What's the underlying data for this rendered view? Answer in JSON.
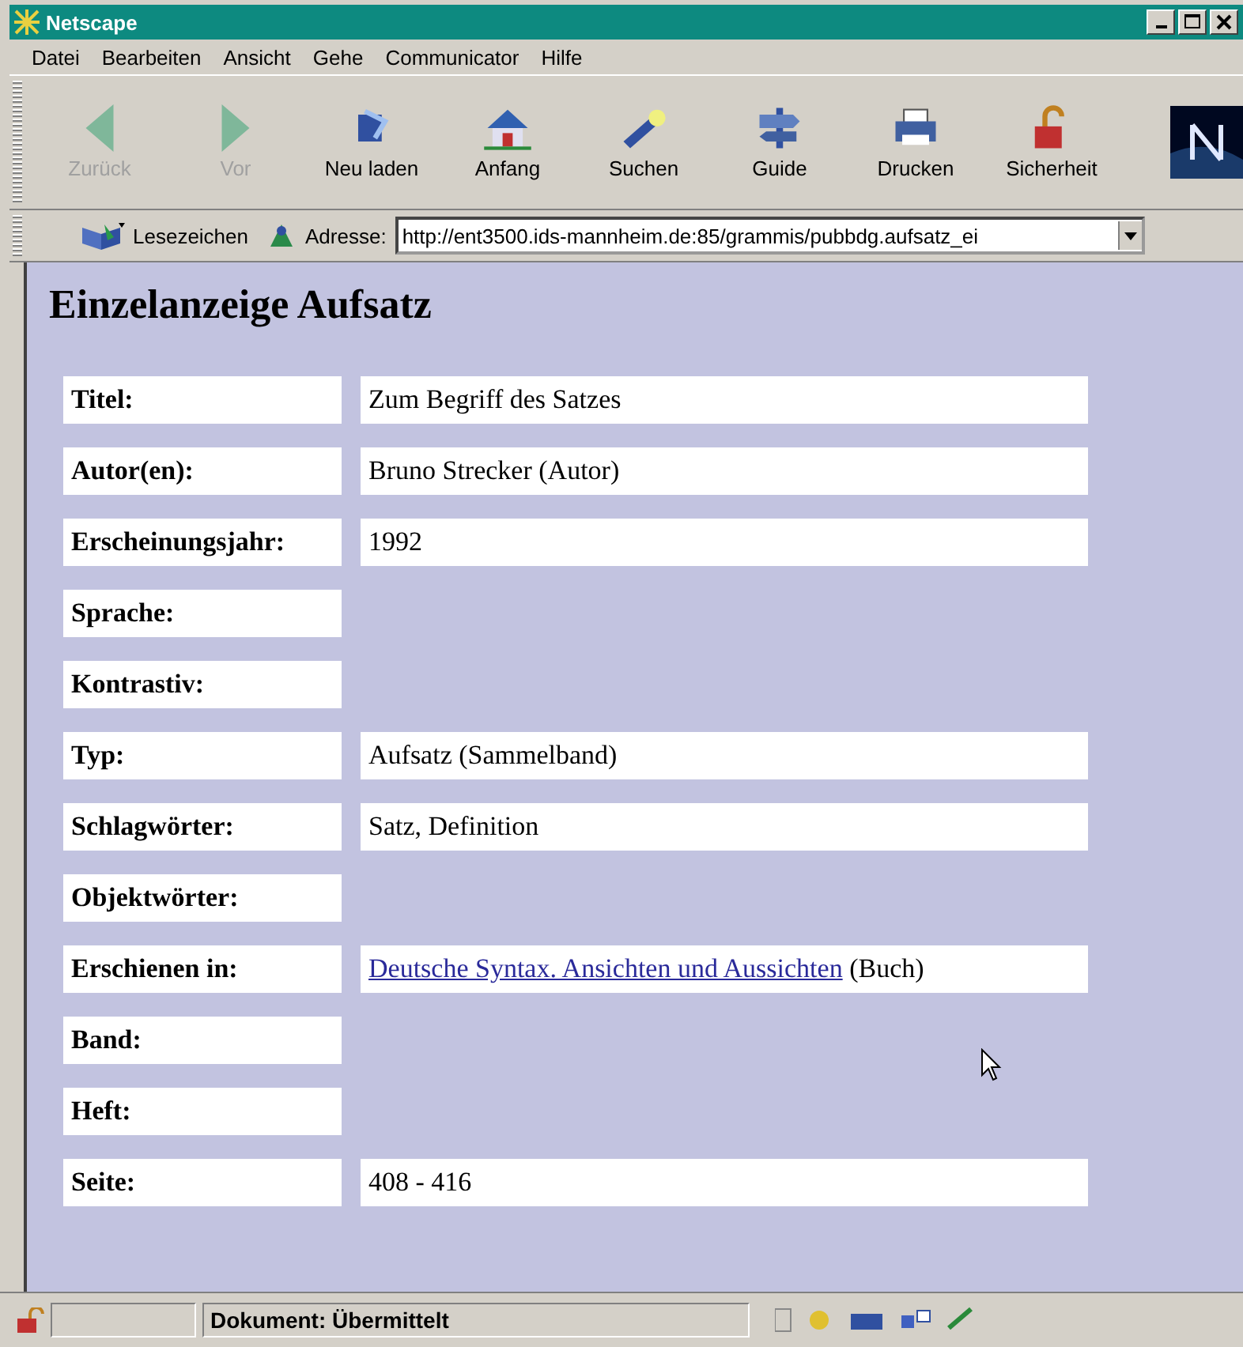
{
  "window": {
    "title": "Netscape"
  },
  "menu": [
    "Datei",
    "Bearbeiten",
    "Ansicht",
    "Gehe",
    "Communicator",
    "Hilfe"
  ],
  "toolbar": [
    {
      "label": "Zurück",
      "disabled": true
    },
    {
      "label": "Vor",
      "disabled": true
    },
    {
      "label": "Neu laden",
      "disabled": false
    },
    {
      "label": "Anfang",
      "disabled": false
    },
    {
      "label": "Suchen",
      "disabled": false
    },
    {
      "label": "Guide",
      "disabled": false
    },
    {
      "label": "Drucken",
      "disabled": false
    },
    {
      "label": "Sicherheit",
      "disabled": false
    }
  ],
  "location_bar": {
    "bookmarks": "Lesezeichen",
    "address_label": "Adresse:",
    "address": "http://ent3500.ids-mannheim.de:85/grammis/pubbdg.aufsatz_ei"
  },
  "page": {
    "heading": "Einzelanzeige Aufsatz",
    "rows": [
      {
        "label": "Titel:",
        "value": "Zum Begriff des Satzes"
      },
      {
        "label": "Autor(en):",
        "value": "Bruno Strecker (Autor)"
      },
      {
        "label": "Erscheinungsjahr:",
        "value": "1992"
      },
      {
        "label": "Sprache:"
      },
      {
        "label": "Kontrastiv:"
      },
      {
        "label": "Typ:",
        "value": "Aufsatz (Sammelband)"
      },
      {
        "label": "Schlagwörter:",
        "value": "Satz, Definition"
      },
      {
        "label": "Objektwörter:"
      },
      {
        "label": "Erschienen in:",
        "link": "Deutsche Syntax. Ansichten und Aussichten",
        "value": "(Buch)"
      },
      {
        "label": "Band:"
      },
      {
        "label": "Heft:"
      },
      {
        "label": "Seite:",
        "value": "408 - 416"
      }
    ]
  },
  "status_bar": {
    "text": "Dokument: Übermittelt"
  }
}
